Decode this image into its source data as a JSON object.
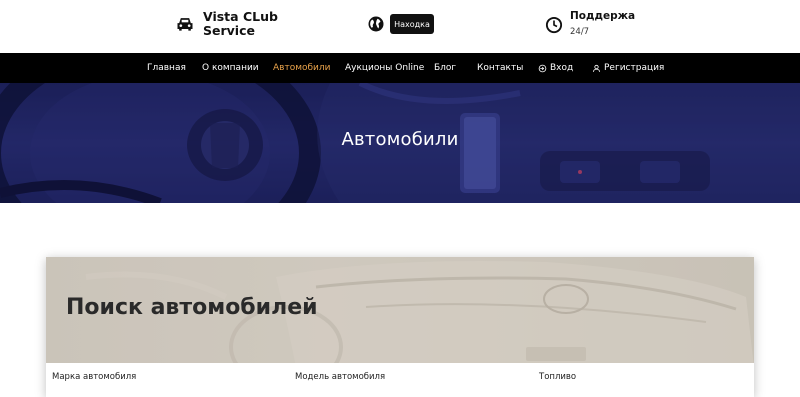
{
  "header": {
    "brand_line1": "Vista CLub",
    "brand_line2": "Service",
    "lost_found_label": "Находка",
    "support_title": "Поддержа",
    "support_hours": "24/7"
  },
  "nav": {
    "items": [
      "Главная",
      "О компании",
      "Автомобили",
      "Аукционы Online",
      "Блог",
      "Контакты"
    ],
    "login": "Вход",
    "register": "Регистрация",
    "active_color": "#e8a24a"
  },
  "hero": {
    "title": "Автомобили"
  },
  "search": {
    "title": "Поиск автомобилей",
    "fields": [
      "Марка автомобиля",
      "Модель автомобиля",
      "Топливо"
    ]
  },
  "icons": {
    "brand": "car-icon",
    "lang": "globe-icon",
    "support": "clock-icon",
    "login": "login-icon",
    "register": "user-icon"
  }
}
